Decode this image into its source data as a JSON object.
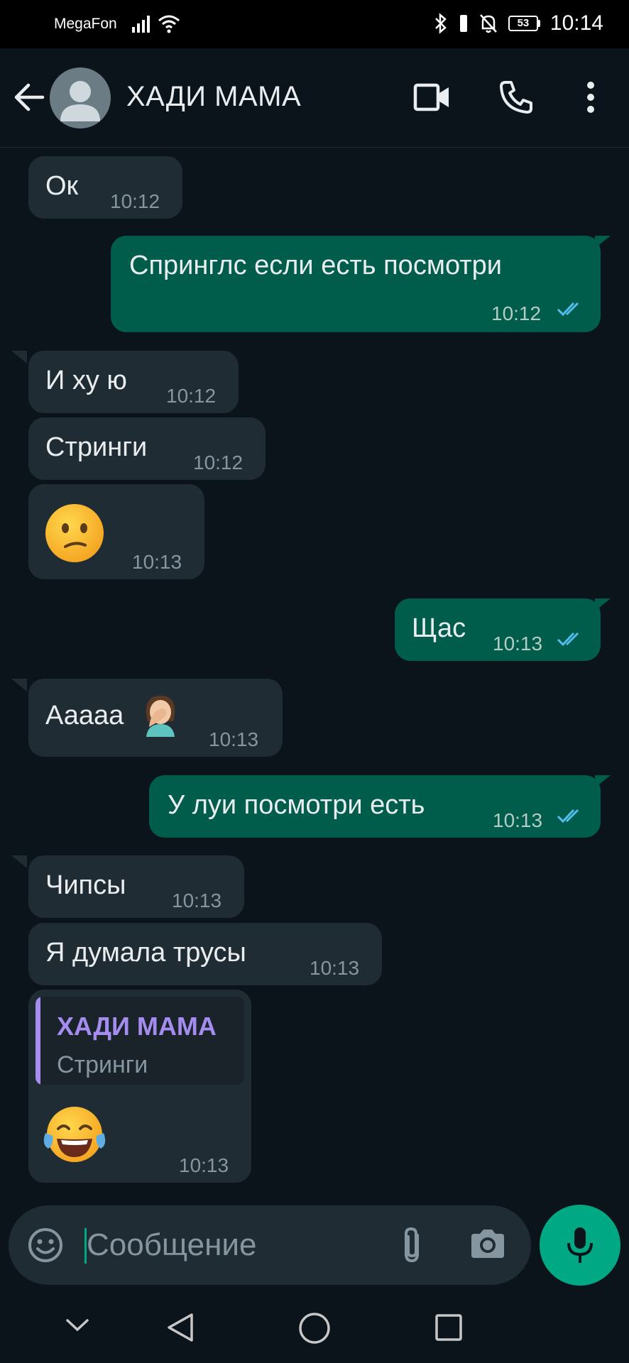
{
  "status_bar": {
    "carrier": "MegaFon",
    "battery": "53",
    "time": "10:14"
  },
  "header": {
    "title": "ХАДИ МАМА"
  },
  "messages": [
    {
      "dir": "in",
      "text": "Ок",
      "time": "10:12"
    },
    {
      "dir": "out",
      "text": "Спринглс если есть посмотри",
      "time": "10:12"
    },
    {
      "dir": "in",
      "text": "И ху ю",
      "time": "10:12"
    },
    {
      "dir": "in",
      "text": "Стринги",
      "time": "10:12"
    },
    {
      "dir": "in",
      "emoji": "confused-face",
      "time": "10:13"
    },
    {
      "dir": "out",
      "text": "Щас",
      "time": "10:13"
    },
    {
      "dir": "in",
      "text": "Ааааа",
      "emoji": "woman-facepalming",
      "time": "10:13"
    },
    {
      "dir": "out",
      "text": "У луи посмотри есть",
      "time": "10:13"
    },
    {
      "dir": "in",
      "text": "Чипсы",
      "time": "10:13"
    },
    {
      "dir": "in",
      "text": "Я думала трусы",
      "time": "10:13"
    },
    {
      "dir": "in",
      "reply_to": {
        "name": "ХАДИ МАМА",
        "text": "Стринги"
      },
      "emoji": "face-with-tears-of-joy",
      "time": "10:13"
    }
  ],
  "composer": {
    "placeholder": "Сообщение"
  },
  "colors": {
    "background": "#0b141a",
    "incoming": "#202c33",
    "outgoing": "#005c4b",
    "accent": "#00a884",
    "read_ticks": "#53bdeb",
    "reply_name": "#a58df0"
  }
}
